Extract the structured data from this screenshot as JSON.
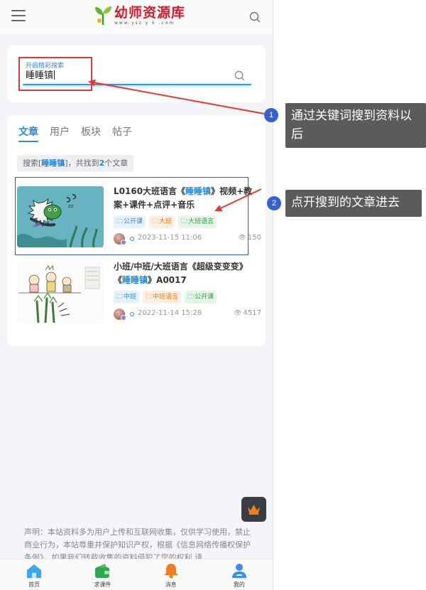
{
  "header": {
    "logo_name": "幼师资源库",
    "logo_url": "www.ysz y k .com",
    "icons": {
      "menu": "menu-icon",
      "search": "search-icon",
      "logo": "sprout-logo-icon"
    }
  },
  "search": {
    "label": "开启精彩搜索",
    "value": "睡睡镇",
    "accent_color": "#2e9ae0",
    "highlight_color": "#e53935"
  },
  "results": {
    "tabs": [
      {
        "label": "文章",
        "active": true
      },
      {
        "label": "用户",
        "active": false
      },
      {
        "label": "板块",
        "active": false
      },
      {
        "label": "帖子",
        "active": false
      }
    ],
    "summary": {
      "prefix": "搜索[",
      "keyword": "睡睡镇",
      "middle": "]，共找到",
      "count": "2",
      "suffix": "个文章"
    },
    "articles": [
      {
        "title_before": "L0160大班语言《",
        "title_keyword": "睡睡镇",
        "title_after": "》视频+教案+课件+点评+音乐",
        "tags": [
          {
            "label": "公开课",
            "color": "blue"
          },
          {
            "label": "大班",
            "color": "orange"
          },
          {
            "label": "大班语言",
            "color": "green"
          }
        ],
        "date": "2023-11-15 11:06",
        "views": "150"
      },
      {
        "title_before": "小班/中班/大班语言《超级变变变》《",
        "title_keyword": "睡睡镇",
        "title_after": "》A0017",
        "tags": [
          {
            "label": "中班",
            "color": "blue"
          },
          {
            "label": "中班语言",
            "color": "orange"
          },
          {
            "label": "公开课",
            "color": "green"
          }
        ],
        "date": "2022-11-14 15:28",
        "views": "4517"
      }
    ]
  },
  "disclaimer": "声明：本站资料多为用户上传和互联网收集，仅供学习使用，禁止商业行为，本站尊重并保护知识产权，根据《信息网络传播权保护条例》，如果我们转载收集的资料侵犯了您的权利,请",
  "tabbar": {
    "items": [
      {
        "label": "首页",
        "icon": "home-icon"
      },
      {
        "label": "求课件",
        "icon": "wallet-icon"
      },
      {
        "label": "消息",
        "icon": "bell-icon"
      },
      {
        "label": "我的",
        "icon": "user-icon"
      }
    ]
  },
  "annotations": [
    {
      "num": "1",
      "text": "通过关键词搜到资料以后"
    },
    {
      "num": "2",
      "text": "点开搜到的文章进去"
    }
  ],
  "colors": {
    "brand_red": "#d7192a",
    "link_blue": "#1f8ad9",
    "annotation_blue": "#3760d4",
    "annotation_box": "#5b5b5b",
    "arrow_red": "#e53935"
  }
}
